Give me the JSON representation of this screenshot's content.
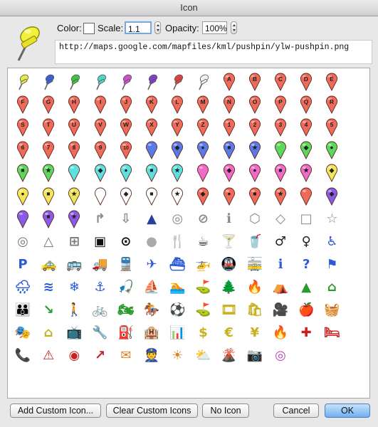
{
  "window": {
    "title": "Icon"
  },
  "header": {
    "color_label": "Color:",
    "scale_label": "Scale:",
    "scale_value": "1.1",
    "opacity_label": "Opacity:",
    "opacity_value": "100%",
    "url": "http://maps.google.com/mapfiles/kml/pushpin/ylw-pushpin.png",
    "selected_color": "#ffffff"
  },
  "buttons": {
    "add_custom": "Add Custom Icon...",
    "clear_custom": "Clear Custom Icons",
    "no_icon": "No Icon",
    "cancel": "Cancel",
    "ok": "OK"
  },
  "icon_rows": [
    [
      {
        "t": "pushpin",
        "c": "#e8e84a",
        "name": "pushpin-yellow"
      },
      {
        "t": "pushpin",
        "c": "#3a62d8",
        "name": "pushpin-blue"
      },
      {
        "t": "pushpin",
        "c": "#3fc43f",
        "name": "pushpin-green"
      },
      {
        "t": "pushpin",
        "c": "#4fd4c8",
        "name": "pushpin-lightblue"
      },
      {
        "t": "pushpin",
        "c": "#d050c8",
        "name": "pushpin-pink"
      },
      {
        "t": "pushpin",
        "c": "#8040c8",
        "name": "pushpin-purple"
      },
      {
        "t": "pushpin",
        "c": "#e04040",
        "name": "pushpin-red"
      },
      {
        "t": "pushpin",
        "c": "#f4f4f4",
        "name": "pushpin-white"
      },
      {
        "t": "pin",
        "c": "#f06a5a",
        "g": "A"
      },
      {
        "t": "pin",
        "c": "#f06a5a",
        "g": "B"
      },
      {
        "t": "pin",
        "c": "#f06a5a",
        "g": "C"
      },
      {
        "t": "pin",
        "c": "#f06a5a",
        "g": "D"
      },
      {
        "t": "pin",
        "c": "#f06a5a",
        "g": "E"
      }
    ],
    [
      {
        "t": "pin",
        "c": "#f06a5a",
        "g": "F"
      },
      {
        "t": "pin",
        "c": "#f06a5a",
        "g": "G"
      },
      {
        "t": "pin",
        "c": "#f06a5a",
        "g": "H"
      },
      {
        "t": "pin",
        "c": "#f06a5a",
        "g": "I"
      },
      {
        "t": "pin",
        "c": "#f06a5a",
        "g": "J"
      },
      {
        "t": "pin",
        "c": "#f06a5a",
        "g": "K"
      },
      {
        "t": "pin",
        "c": "#f06a5a",
        "g": "L"
      },
      {
        "t": "pin",
        "c": "#f06a5a",
        "g": "M"
      },
      {
        "t": "pin",
        "c": "#f06a5a",
        "g": "N"
      },
      {
        "t": "pin",
        "c": "#f06a5a",
        "g": "O"
      },
      {
        "t": "pin",
        "c": "#f06a5a",
        "g": "P"
      },
      {
        "t": "pin",
        "c": "#f06a5a",
        "g": "Q"
      },
      {
        "t": "pin",
        "c": "#f06a5a",
        "g": "R"
      }
    ],
    [
      {
        "t": "pin",
        "c": "#f06a5a",
        "g": "S"
      },
      {
        "t": "pin",
        "c": "#f06a5a",
        "g": "T"
      },
      {
        "t": "pin",
        "c": "#f06a5a",
        "g": "U"
      },
      {
        "t": "pin",
        "c": "#f06a5a",
        "g": "V"
      },
      {
        "t": "pin",
        "c": "#f06a5a",
        "g": "W"
      },
      {
        "t": "pin",
        "c": "#f06a5a",
        "g": "X"
      },
      {
        "t": "pin",
        "c": "#f06a5a",
        "g": "Y"
      },
      {
        "t": "pin",
        "c": "#f06a5a",
        "g": "Z"
      },
      {
        "t": "pin",
        "c": "#f06a5a",
        "g": "1"
      },
      {
        "t": "pin",
        "c": "#f06a5a",
        "g": "2"
      },
      {
        "t": "pin",
        "c": "#f06a5a",
        "g": "3"
      },
      {
        "t": "pin",
        "c": "#f06a5a",
        "g": "4"
      },
      {
        "t": "pin",
        "c": "#f06a5a",
        "g": "5"
      }
    ],
    [
      {
        "t": "pin",
        "c": "#f06a5a",
        "g": "6"
      },
      {
        "t": "pin",
        "c": "#f06a5a",
        "g": "7"
      },
      {
        "t": "pin",
        "c": "#f06a5a",
        "g": "8"
      },
      {
        "t": "pin",
        "c": "#f06a5a",
        "g": "9"
      },
      {
        "t": "pin",
        "c": "#f06a5a",
        "g": "10"
      },
      {
        "t": "pin",
        "c": "#5a7ae8",
        "g": ""
      },
      {
        "t": "pin",
        "c": "#5a7ae8",
        "g": "◆"
      },
      {
        "t": "pin",
        "c": "#5a7ae8",
        "g": "●"
      },
      {
        "t": "pin",
        "c": "#5a7ae8",
        "g": "■"
      },
      {
        "t": "pin",
        "c": "#5a7ae8",
        "g": "★"
      },
      {
        "t": "pin",
        "c": "#5cd85c",
        "g": ""
      },
      {
        "t": "pin",
        "c": "#5cd85c",
        "g": "◆"
      },
      {
        "t": "pin",
        "c": "#5cd85c",
        "g": "●"
      }
    ],
    [
      {
        "t": "pin",
        "c": "#5cd85c",
        "g": "■"
      },
      {
        "t": "pin",
        "c": "#5cd85c",
        "g": "★"
      },
      {
        "t": "pin",
        "c": "#5ee0e0",
        "g": ""
      },
      {
        "t": "pin",
        "c": "#5ee0e0",
        "g": "◆"
      },
      {
        "t": "pin",
        "c": "#5ee0e0",
        "g": "●"
      },
      {
        "t": "pin",
        "c": "#5ee0e0",
        "g": "■"
      },
      {
        "t": "pin",
        "c": "#5ee0e0",
        "g": "★"
      },
      {
        "t": "pin",
        "c": "#f06ac8",
        "g": ""
      },
      {
        "t": "pin",
        "c": "#f06ac8",
        "g": "◆"
      },
      {
        "t": "pin",
        "c": "#f06ac8",
        "g": "●"
      },
      {
        "t": "pin",
        "c": "#f06ac8",
        "g": "■"
      },
      {
        "t": "pin",
        "c": "#f06ac8",
        "g": "★"
      },
      {
        "t": "pin",
        "c": "#f0e85a",
        "g": "◆"
      }
    ],
    [
      {
        "t": "pin",
        "c": "#f0e85a",
        "g": "●"
      },
      {
        "t": "pin",
        "c": "#f0e85a",
        "g": "■"
      },
      {
        "t": "pin",
        "c": "#f0e85a",
        "g": "★"
      },
      {
        "t": "pin",
        "c": "#ffffff",
        "g": ""
      },
      {
        "t": "pin",
        "c": "#ffffff",
        "g": "◆"
      },
      {
        "t": "pin",
        "c": "#ffffff",
        "g": "■"
      },
      {
        "t": "pin",
        "c": "#ffffff",
        "g": "★"
      },
      {
        "t": "pin",
        "c": "#f06a5a",
        "g": "◆"
      },
      {
        "t": "pin",
        "c": "#f06a5a",
        "g": "●"
      },
      {
        "t": "pin",
        "c": "#f06a5a",
        "g": "■"
      },
      {
        "t": "pin",
        "c": "#f06a5a",
        "g": "★"
      },
      {
        "t": "pin",
        "c": "#f06a5a",
        "g": ""
      },
      {
        "t": "pin",
        "c": "#8a5ae8",
        "g": "◆"
      }
    ],
    [
      {
        "t": "pin",
        "c": "#8a5ae8",
        "g": ""
      },
      {
        "t": "pin",
        "c": "#8a5ae8",
        "g": "■"
      },
      {
        "t": "pin",
        "c": "#8a5ae8",
        "g": "★"
      },
      {
        "t": "glyph",
        "g": "↱",
        "fg": "#888",
        "name": "arrow-curve-icon"
      },
      {
        "t": "glyph",
        "g": "⇩",
        "fg": "#888",
        "name": "arrow-down-icon"
      },
      {
        "t": "glyph",
        "g": "▲",
        "fg": "#2a3f9a",
        "name": "navigation-arrow-icon"
      },
      {
        "t": "glyph",
        "g": "◎",
        "fg": "#888",
        "name": "ring-icon"
      },
      {
        "t": "glyph",
        "g": "⊘",
        "fg": "#888",
        "name": "forbidden-icon"
      },
      {
        "t": "glyph",
        "g": "ℹ",
        "fg": "#888",
        "name": "info-outline-icon"
      },
      {
        "t": "glyph",
        "g": "⬡",
        "fg": "#888",
        "name": "hexagon-icon"
      },
      {
        "t": "glyph",
        "g": "◇",
        "fg": "#888",
        "name": "diamond-outline-icon"
      },
      {
        "t": "glyph",
        "g": "□",
        "fg": "#888",
        "name": "square-outline-icon"
      },
      {
        "t": "glyph",
        "g": "☆",
        "fg": "#888",
        "name": "star-outline-icon"
      }
    ],
    [
      {
        "t": "glyph",
        "g": "◎",
        "fg": "#777",
        "name": "target-icon"
      },
      {
        "t": "glyph",
        "g": "△",
        "fg": "#777",
        "name": "triangle-outline-icon"
      },
      {
        "t": "glyph",
        "g": "⊞",
        "fg": "#777",
        "name": "crosshair-square-icon"
      },
      {
        "t": "glyph",
        "g": "▣",
        "fg": "#111",
        "name": "square-dot-icon"
      },
      {
        "t": "glyph",
        "g": "⊙",
        "fg": "#111",
        "name": "circle-dot-icon"
      },
      {
        "t": "glyph",
        "g": "●",
        "fg": "#aaa",
        "name": "grey-dot-icon"
      },
      {
        "t": "glyph",
        "g": "🍴",
        "fg": "#222",
        "name": "restaurant-icon"
      },
      {
        "t": "glyph",
        "g": "☕",
        "fg": "#222",
        "name": "coffee-icon"
      },
      {
        "t": "glyph",
        "g": "🍸",
        "fg": "#222",
        "name": "bar-icon"
      },
      {
        "t": "glyph",
        "g": "🥤",
        "fg": "#222",
        "name": "snack-bar-icon"
      },
      {
        "t": "glyph",
        "g": "♂",
        "fg": "#222",
        "name": "man-icon"
      },
      {
        "t": "glyph",
        "g": "♀",
        "fg": "#222",
        "name": "woman-icon"
      },
      {
        "t": "glyph",
        "g": "♿",
        "fg": "#2a5ad8",
        "name": "wheelchair-icon"
      }
    ],
    [
      {
        "t": "glyph",
        "g": "P",
        "fg": "#2a5ad8",
        "name": "parking-icon"
      },
      {
        "t": "glyph",
        "g": "🚕",
        "fg": "#2a5ad8",
        "name": "taxi-icon"
      },
      {
        "t": "glyph",
        "g": "🚌",
        "fg": "#2a5ad8",
        "name": "bus-icon"
      },
      {
        "t": "glyph",
        "g": "🚚",
        "fg": "#2a5ad8",
        "name": "truck-icon"
      },
      {
        "t": "glyph",
        "g": "🚆",
        "fg": "#2a5ad8",
        "name": "rail-icon"
      },
      {
        "t": "glyph",
        "g": "✈",
        "fg": "#2a5ad8",
        "name": "airport-icon"
      },
      {
        "t": "glyph",
        "g": "⛴",
        "fg": "#2a5ad8",
        "name": "ferry-icon"
      },
      {
        "t": "glyph",
        "g": "🚁",
        "fg": "#2a5ad8",
        "name": "heliport-icon"
      },
      {
        "t": "glyph",
        "g": "🚇",
        "fg": "#2a5ad8",
        "name": "subway-icon"
      },
      {
        "t": "glyph",
        "g": "🚋",
        "fg": "#2a5ad8",
        "name": "tram-icon"
      },
      {
        "t": "glyph",
        "g": "ℹ",
        "fg": "#2a5ad8",
        "name": "info-icon"
      },
      {
        "t": "glyph",
        "g": "?",
        "fg": "#2a5ad8",
        "name": "help-icon"
      },
      {
        "t": "glyph",
        "g": "⚑",
        "fg": "#2a5ad8",
        "name": "flag-icon"
      }
    ],
    [
      {
        "t": "glyph",
        "g": "🌧",
        "fg": "#2a5ad8",
        "name": "rain-icon"
      },
      {
        "t": "glyph",
        "g": "≋",
        "fg": "#2a5ad8",
        "name": "water-icon"
      },
      {
        "t": "glyph",
        "g": "❄",
        "fg": "#2a5ad8",
        "name": "snowflake-icon"
      },
      {
        "t": "glyph",
        "g": "⚓",
        "fg": "#2a5ad8",
        "name": "marina-icon"
      },
      {
        "t": "glyph",
        "g": "🎣",
        "fg": "#2a5ad8",
        "name": "fishing-icon"
      },
      {
        "t": "glyph",
        "g": "⛵",
        "fg": "#2a5ad8",
        "name": "sailing-icon"
      },
      {
        "t": "glyph",
        "g": "🏊",
        "fg": "#2a5ad8",
        "name": "swimming-icon"
      },
      {
        "t": "glyph",
        "g": "⛳",
        "fg": "#2a9a2a",
        "name": "golf-icon"
      },
      {
        "t": "glyph",
        "g": "🌲",
        "fg": "#2a9a2a",
        "name": "park-icon"
      },
      {
        "t": "glyph",
        "g": "🔥",
        "fg": "#2a9a2a",
        "name": "campfire-icon"
      },
      {
        "t": "glyph",
        "g": "⛺",
        "fg": "#2a9a2a",
        "name": "picnic-icon"
      },
      {
        "t": "glyph",
        "g": "▲",
        "fg": "#2a9a2a",
        "name": "campground-icon"
      },
      {
        "t": "glyph",
        "g": "⌂",
        "fg": "#2a9a2a",
        "name": "ranger-station-icon"
      }
    ],
    [
      {
        "t": "glyph",
        "g": "👪",
        "fg": "#2a9a2a",
        "name": "toilets-icon"
      },
      {
        "t": "glyph",
        "g": "↘",
        "fg": "#2a9a2a",
        "name": "poi-arrow-icon"
      },
      {
        "t": "glyph",
        "g": "🚶",
        "fg": "#2a9a2a",
        "name": "hiker-icon"
      },
      {
        "t": "glyph",
        "g": "🚲",
        "fg": "#2a9a2a",
        "name": "cycling-icon"
      },
      {
        "t": "glyph",
        "g": "🏍",
        "fg": "#2a9a2a",
        "name": "motorcycling-icon"
      },
      {
        "t": "glyph",
        "g": "🏇",
        "fg": "#2a9a2a",
        "name": "horse-riding-icon"
      },
      {
        "t": "glyph",
        "g": "⚽",
        "fg": "#2a9a2a",
        "name": "sports-icon"
      },
      {
        "t": "glyph",
        "g": "⛳",
        "fg": "#2a9a2a",
        "name": "golf-course-icon"
      },
      {
        "t": "glyph",
        "g": "🎞",
        "fg": "#c8b020",
        "name": "movies-icon"
      },
      {
        "t": "glyph",
        "g": "🛍",
        "fg": "#c8b020",
        "name": "shopping-icon"
      },
      {
        "t": "glyph",
        "g": "🎥",
        "fg": "#c8b020",
        "name": "camera-icon"
      },
      {
        "t": "glyph",
        "g": "🍎",
        "fg": "#c8b020",
        "name": "grocery-icon"
      },
      {
        "t": "glyph",
        "g": "🧺",
        "fg": "#c8b020",
        "name": "basket-icon"
      }
    ],
    [
      {
        "t": "glyph",
        "g": "🎭",
        "fg": "#c8b020",
        "name": "arts-icon"
      },
      {
        "t": "glyph",
        "g": "⌂",
        "fg": "#c8b020",
        "name": "homegardenbusiness-icon"
      },
      {
        "t": "glyph",
        "g": "📺",
        "fg": "#c8b020",
        "name": "electronics-icon"
      },
      {
        "t": "glyph",
        "g": "🔧",
        "fg": "#c8b020",
        "name": "mechanic-icon"
      },
      {
        "t": "glyph",
        "g": "⛽",
        "fg": "#c8b020",
        "name": "gas-station-icon"
      },
      {
        "t": "glyph",
        "g": "🏨",
        "fg": "#c8b020",
        "name": "real-estate-icon"
      },
      {
        "t": "glyph",
        "g": "📊",
        "fg": "#c8b020",
        "name": "salon-icon"
      },
      {
        "t": "glyph",
        "g": "$",
        "fg": "#c8b020",
        "name": "dollar-icon"
      },
      {
        "t": "glyph",
        "g": "€",
        "fg": "#c8b020",
        "name": "euro-icon"
      },
      {
        "t": "glyph",
        "g": "¥",
        "fg": "#c8b020",
        "name": "yen-icon"
      },
      {
        "t": "glyph",
        "g": "🔥",
        "fg": "#c82020",
        "name": "fire-icon"
      },
      {
        "t": "glyph",
        "g": "✚",
        "fg": "#c82020",
        "name": "hospital-icon"
      },
      {
        "t": "glyph",
        "g": "🛏",
        "fg": "#c82020",
        "name": "lodging-icon"
      }
    ],
    [
      {
        "t": "glyph",
        "g": "📞",
        "fg": "#c82020",
        "name": "phone-icon"
      },
      {
        "t": "glyph",
        "g": "⚠",
        "fg": "#c82020",
        "name": "caution-icon"
      },
      {
        "t": "glyph",
        "g": "◉",
        "fg": "#c82020",
        "name": "earthquake-icon"
      },
      {
        "t": "glyph",
        "g": "↗",
        "fg": "#c82020",
        "name": "falling-rocks-icon"
      },
      {
        "t": "glyph",
        "g": "✉",
        "fg": "#e08020",
        "name": "post-office-icon"
      },
      {
        "t": "glyph",
        "g": "👮",
        "fg": "#e08020",
        "name": "police-icon"
      },
      {
        "t": "glyph",
        "g": "☀",
        "fg": "#e08020",
        "name": "sunny-icon"
      },
      {
        "t": "glyph",
        "g": "⛅",
        "fg": "#e08020",
        "name": "partly-cloudy-icon"
      },
      {
        "t": "glyph",
        "g": "🌋",
        "fg": "#e08020",
        "name": "volcano-icon"
      },
      {
        "t": "glyph",
        "g": "📷",
        "fg": "#c040c0",
        "name": "camera-purple-icon"
      },
      {
        "t": "glyph",
        "g": "◎",
        "fg": "#c040c0",
        "name": "webcam-icon"
      }
    ]
  ]
}
